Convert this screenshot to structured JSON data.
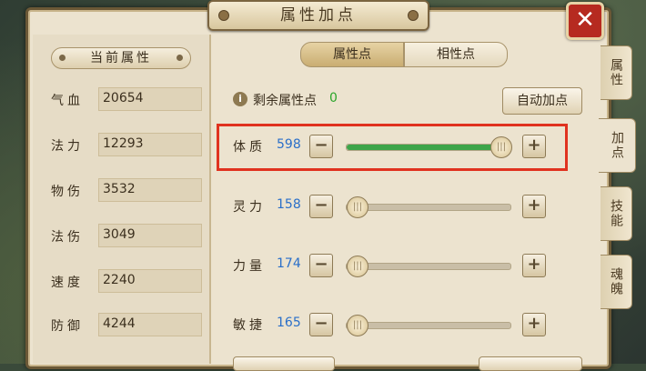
{
  "window": {
    "title": "属性加点",
    "close_label": "✕"
  },
  "left_panel": {
    "header": "当前属性",
    "stats": [
      {
        "label": "气血",
        "value": "20654"
      },
      {
        "label": "法力",
        "value": "12293"
      },
      {
        "label": "物伤",
        "value": "3532"
      },
      {
        "label": "法伤",
        "value": "3049"
      },
      {
        "label": "速度",
        "value": "2240"
      },
      {
        "label": "防御",
        "value": "4244"
      }
    ]
  },
  "tabs": [
    {
      "label": "属性点",
      "active": true
    },
    {
      "label": "相性点",
      "active": false
    }
  ],
  "remaining": {
    "label": "剩余属性点",
    "value": "0",
    "info_icon": "info-icon"
  },
  "auto_button": "自动加点",
  "attributes": [
    {
      "label": "体质",
      "value": "598",
      "level": 1.0
    },
    {
      "label": "灵力",
      "value": "158",
      "level": 0.0
    },
    {
      "label": "力量",
      "value": "174",
      "level": 0.0
    },
    {
      "label": "敏捷",
      "value": "165",
      "level": 0.0
    }
  ],
  "side_tabs": [
    {
      "label": "属性",
      "active": false
    },
    {
      "label": "加点",
      "active": true
    },
    {
      "label": "技能",
      "active": false
    },
    {
      "label": "魂魄",
      "active": false
    }
  ],
  "colors": {
    "accent_green": "#3da54a",
    "value_blue": "#2a6fc9",
    "highlight_red": "#e0321f"
  }
}
